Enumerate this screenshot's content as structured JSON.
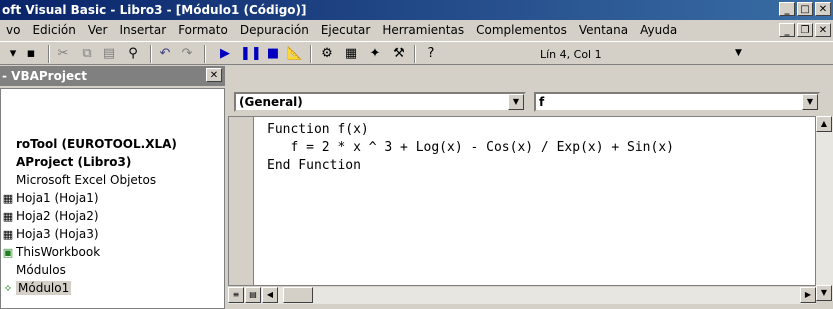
{
  "window": {
    "title": "oft Visual Basic - Libro3 - [Módulo1 (Código)]"
  },
  "menu": [
    "vo",
    "Edición",
    "Ver",
    "Insertar",
    "Formato",
    "Depuración",
    "Ejecutar",
    "Herramientas",
    "Complementos",
    "Ventana",
    "Ayuda"
  ],
  "toolbar": {
    "position": "Lín 4, Col 1"
  },
  "project": {
    "title": "- VBAProject",
    "tree": [
      {
        "label": "roTool (EUROTOOL.XLA)",
        "bold": true,
        "icon": ""
      },
      {
        "label": "AProject (Libro3)",
        "bold": true,
        "icon": ""
      },
      {
        "label": "Microsoft Excel Objetos",
        "bold": false,
        "icon": ""
      },
      {
        "label": "Hoja1 (Hoja1)",
        "bold": false,
        "icon": "sheet-icon"
      },
      {
        "label": "Hoja2 (Hoja2)",
        "bold": false,
        "icon": "sheet-icon"
      },
      {
        "label": "Hoja3 (Hoja3)",
        "bold": false,
        "icon": "sheet-icon"
      },
      {
        "label": "ThisWorkbook",
        "bold": false,
        "icon": "workbook-icon"
      },
      {
        "label": "Módulos",
        "bold": false,
        "icon": ""
      },
      {
        "label": "Módulo1",
        "bold": false,
        "icon": "module-icon",
        "selected": true
      }
    ]
  },
  "code": {
    "object_combo": "(General)",
    "proc_combo": "f",
    "lines": [
      "Function f(x)",
      "   f = 2 * x ^ 3 + Log(x) - Cos(x) / Exp(x) + Sin(x)",
      "End Function"
    ]
  }
}
